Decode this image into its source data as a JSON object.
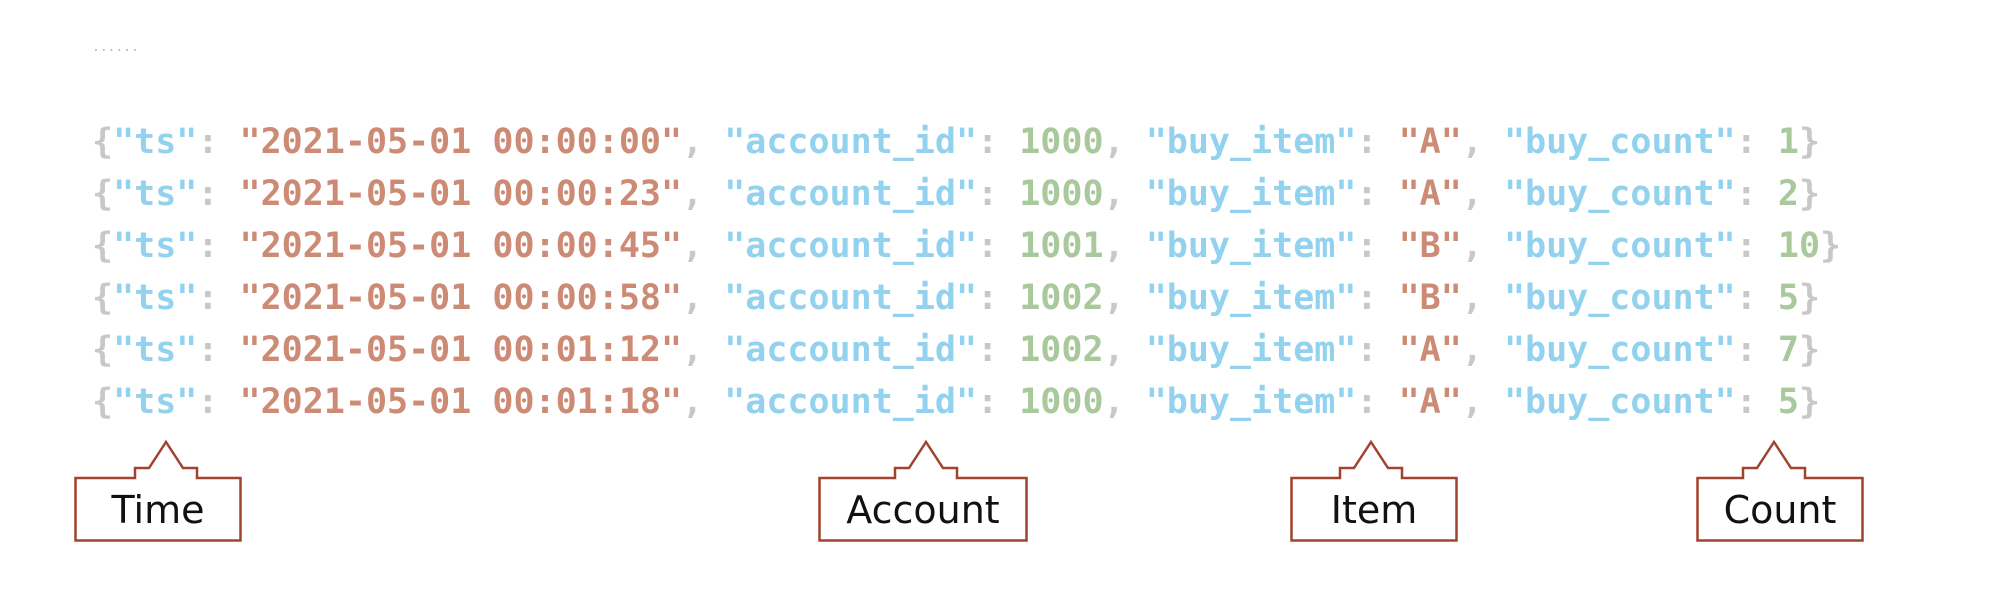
{
  "ellipsis": "......",
  "records": [
    {
      "ts": "2021-05-01 00:00:00",
      "account_id": "1000",
      "buy_item": "A",
      "buy_count": "1"
    },
    {
      "ts": "2021-05-01 00:00:23",
      "account_id": "1000",
      "buy_item": "A",
      "buy_count": "2"
    },
    {
      "ts": "2021-05-01 00:00:45",
      "account_id": "1001",
      "buy_item": "B",
      "buy_count": "10"
    },
    {
      "ts": "2021-05-01 00:00:58",
      "account_id": "1002",
      "buy_item": "B",
      "buy_count": "5"
    },
    {
      "ts": "2021-05-01 00:01:12",
      "account_id": "1002",
      "buy_item": "A",
      "buy_count": "7"
    },
    {
      "ts": "2021-05-01 00:01:18",
      "account_id": "1000",
      "buy_item": "A",
      "buy_count": "5"
    }
  ],
  "keys": {
    "ts": "\"ts\"",
    "account_id": "\"account_id\"",
    "buy_item": "\"buy_item\"",
    "buy_count": "\"buy_count\""
  },
  "callouts": {
    "time": "Time",
    "account": "Account",
    "item": "Item",
    "count": "Count"
  },
  "colors": {
    "punctuation": "#c8c8c8",
    "key": "#93d2ef",
    "string_value": "#cd8a74",
    "number_value": "#a9c99d",
    "callout_border": "#a0432f"
  }
}
